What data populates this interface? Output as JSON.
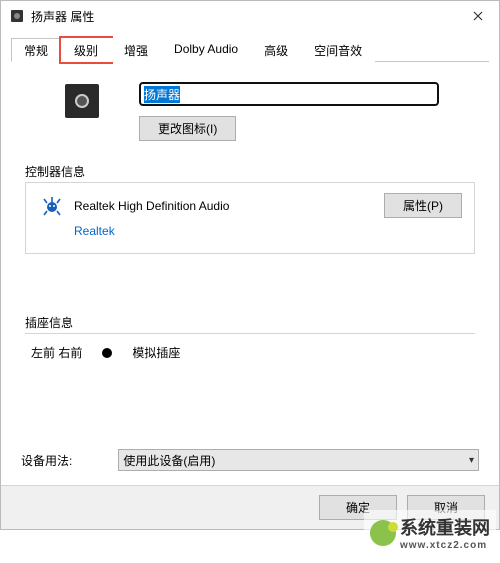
{
  "window": {
    "title": "扬声器 属性"
  },
  "tabs": [
    "常规",
    "级别",
    "增强",
    "Dolby Audio",
    "高级",
    "空间音效"
  ],
  "active_tab_index": 0,
  "highlight_tab_index": 1,
  "device": {
    "name_value": "扬声器",
    "change_icon_btn": "更改图标(I)"
  },
  "controller": {
    "group_label": "控制器信息",
    "name": "Realtek High Definition Audio",
    "vendor_link": "Realtek",
    "properties_btn": "属性(P)"
  },
  "jack": {
    "group_label": "插座信息",
    "position": "左前 右前",
    "type": "模拟插座"
  },
  "usage": {
    "label": "设备用法:",
    "selected": "使用此设备(启用)"
  },
  "footer": {
    "ok": "确定",
    "cancel": "取消"
  },
  "watermark": {
    "brand": "系统重装网",
    "url": "www.xtcz2.com"
  }
}
